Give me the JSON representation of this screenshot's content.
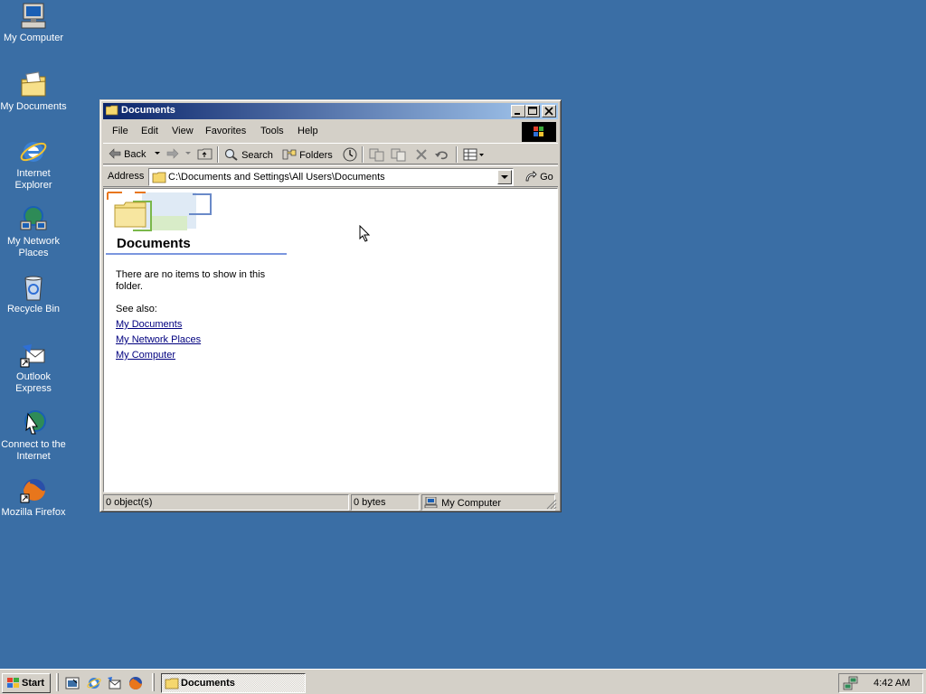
{
  "desktop": {
    "icons": [
      {
        "label": "My Computer"
      },
      {
        "label": "My Documents"
      },
      {
        "label": "Internet Explorer"
      },
      {
        "label": "My Network Places"
      },
      {
        "label": "Recycle Bin"
      },
      {
        "label": "Outlook Express"
      },
      {
        "label": "Connect to the Internet"
      },
      {
        "label": "Mozilla Firefox"
      }
    ],
    "background_color": "#3a6ea5"
  },
  "window": {
    "title": "Documents",
    "menu": [
      "File",
      "Edit",
      "View",
      "Favorites",
      "Tools",
      "Help"
    ],
    "toolbar": {
      "back": "Back",
      "search": "Search",
      "folders": "Folders"
    },
    "address": {
      "label": "Address",
      "value": "C:\\Documents and Settings\\All Users\\Documents",
      "go": "Go"
    },
    "content": {
      "heading": "Documents",
      "message": "There are no items to show in this folder.",
      "see_also": "See also:",
      "links": [
        "My Documents",
        "My Network Places",
        "My Computer"
      ]
    },
    "status": {
      "objects": "0 object(s)",
      "size": "0 bytes",
      "zone": "My Computer"
    },
    "title_gradient": [
      "#0a246a",
      "#a6caf0"
    ]
  },
  "taskbar": {
    "start": "Start",
    "task": "Documents",
    "clock": "4:42 AM"
  }
}
